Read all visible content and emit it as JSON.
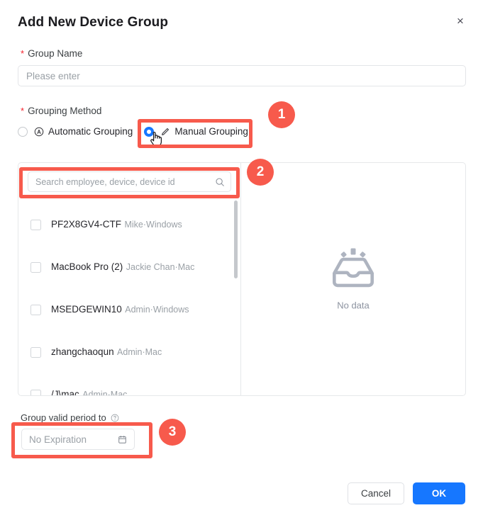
{
  "dialog": {
    "title": "Add New Device Group",
    "close_label": "×"
  },
  "group_name": {
    "label": "Group Name",
    "required_mark": "*",
    "placeholder": "Please enter",
    "value": ""
  },
  "grouping_method": {
    "label": "Grouping Method",
    "required_mark": "*",
    "options": [
      {
        "label": "Automatic Grouping",
        "icon": "automatic-circle-a-icon",
        "selected": false
      },
      {
        "label": "Manual Grouping",
        "icon": "pencil-icon",
        "selected": true
      }
    ]
  },
  "transfer": {
    "search": {
      "placeholder": "Search employee, device, device id",
      "value": "",
      "icon": "search-icon"
    },
    "devices": [
      {
        "name": "PF2X8GV4-CTF",
        "sub": "Mike·Windows",
        "checked": false
      },
      {
        "name": "MacBook Pro (2)",
        "sub": "Jackie Chan·Mac",
        "checked": false
      },
      {
        "name": "MSEDGEWIN10",
        "sub": "Admin·Windows",
        "checked": false
      },
      {
        "name": "zhangchaoqun",
        "sub": "Admin·Mac",
        "checked": false
      },
      {
        "name": "/J\\mac",
        "sub": "Admin·Mac",
        "checked": false
      }
    ],
    "empty": {
      "text": "No data",
      "icon": "empty-inbox-icon"
    }
  },
  "valid_period": {
    "label": "Group valid period to",
    "help_icon": "question-circle-icon",
    "value": "No Expiration",
    "icon": "calendar-icon"
  },
  "footer": {
    "cancel_label": "Cancel",
    "ok_label": "OK"
  },
  "annotations": [
    {
      "number": "1"
    },
    {
      "number": "2"
    },
    {
      "number": "3"
    }
  ],
  "colors": {
    "accent_blue": "#1677ff",
    "annotation_red": "#f75a4c",
    "required_red": "#f5222d"
  }
}
